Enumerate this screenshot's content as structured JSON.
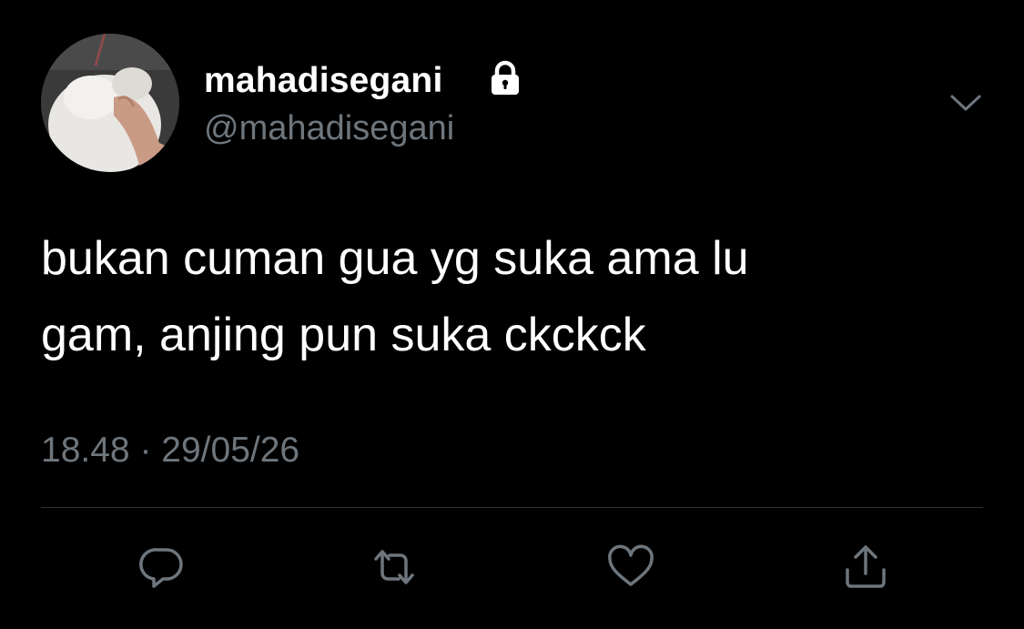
{
  "tweet": {
    "display_name": "mahadisegani",
    "handle": "@mahadisegani",
    "text": "bukan cuman gua yg suka ama lu\ngam, anjing pun suka ckckck",
    "time": "18.48",
    "separator": "·",
    "date": "29/05/26"
  },
  "icons": {
    "lock": "lock-icon",
    "menu": "chevron-down-icon",
    "reply": "reply-icon",
    "retweet": "retweet-icon",
    "like": "heart-icon",
    "share": "share-icon"
  },
  "colors": {
    "background": "#000000",
    "primary_text": "#ffffff",
    "secondary_text": "#6e767d",
    "divider": "#2f3336"
  }
}
